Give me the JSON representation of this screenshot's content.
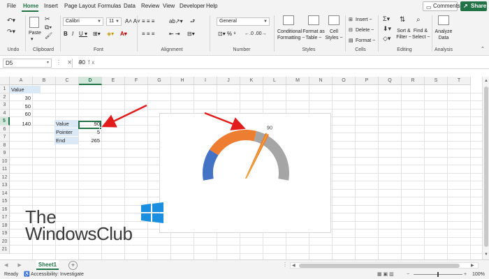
{
  "tabs": [
    "File",
    "Home",
    "Insert",
    "Page Layout",
    "Formulas",
    "Data",
    "Review",
    "View",
    "Developer",
    "Help"
  ],
  "active_tab": "Home",
  "header_buttons": {
    "comments": "Comments",
    "share": "Share"
  },
  "ribbon": {
    "groups": [
      "Undo",
      "Clipboard",
      "Font",
      "Alignment",
      "Number",
      "Styles",
      "Cells",
      "Editing",
      "Analysis"
    ],
    "clipboard": {
      "paste": "Paste"
    },
    "font": {
      "name": "Calibri",
      "size": "11"
    },
    "number": {
      "format": "General"
    },
    "styles": {
      "conditional": [
        "Conditional",
        "Formatting ~"
      ],
      "format_table": [
        "Format as",
        "Table ~"
      ],
      "cell_styles": [
        "Cell",
        "Styles ~"
      ]
    },
    "cells": {
      "insert": "Insert ~",
      "delete": "Delete ~",
      "format": "Format ~"
    },
    "editing": {
      "sort": [
        "Sort &",
        "Filter ~"
      ],
      "find": [
        "Find &",
        "Select ~"
      ]
    },
    "analysis": {
      "analyze": [
        "Analyze",
        "Data"
      ]
    }
  },
  "formula_bar": {
    "name_box": "D5",
    "value": "90"
  },
  "columns": [
    "A",
    "B",
    "C",
    "D",
    "E",
    "F",
    "G",
    "H",
    "I",
    "J",
    "K",
    "L",
    "M",
    "N",
    "O",
    "P",
    "Q",
    "R",
    "S",
    "T"
  ],
  "selected_column": "D",
  "rows": [
    "1",
    "2",
    "3",
    "4",
    "5",
    "6",
    "7",
    "8",
    "9",
    "10",
    "11",
    "12",
    "13",
    "14",
    "15",
    "16",
    "17",
    "18",
    "19",
    "20",
    "21"
  ],
  "selected_row": "5",
  "cells": {
    "A1": "Value",
    "A2": "30",
    "A3": "50",
    "A4": "60",
    "A5": "140",
    "C5": "Value",
    "D5": "90",
    "C6": "Pointer",
    "D6": "5",
    "C7": "End",
    "D7": "265"
  },
  "chart_data": {
    "type": "pie",
    "title": "",
    "data_label": "90",
    "categories": [
      "Blue",
      "Orange",
      "Gray"
    ],
    "values": [
      30,
      50,
      60
    ],
    "colors": [
      "#4472c4",
      "#ed7d31",
      "#a5a5a5"
    ],
    "pointer": {
      "value": 90,
      "width": 5,
      "color": "#ed7d31"
    },
    "gauge_total": 140
  },
  "watermark": {
    "line1": "The",
    "line2": "WindowsClub"
  },
  "sheet_tabs": [
    "Sheet1"
  ],
  "status_bar": {
    "ready": "Ready",
    "accessibility": "Accessibility: Investigate",
    "zoom": "100%"
  },
  "colors": {
    "accent": "#217346"
  }
}
